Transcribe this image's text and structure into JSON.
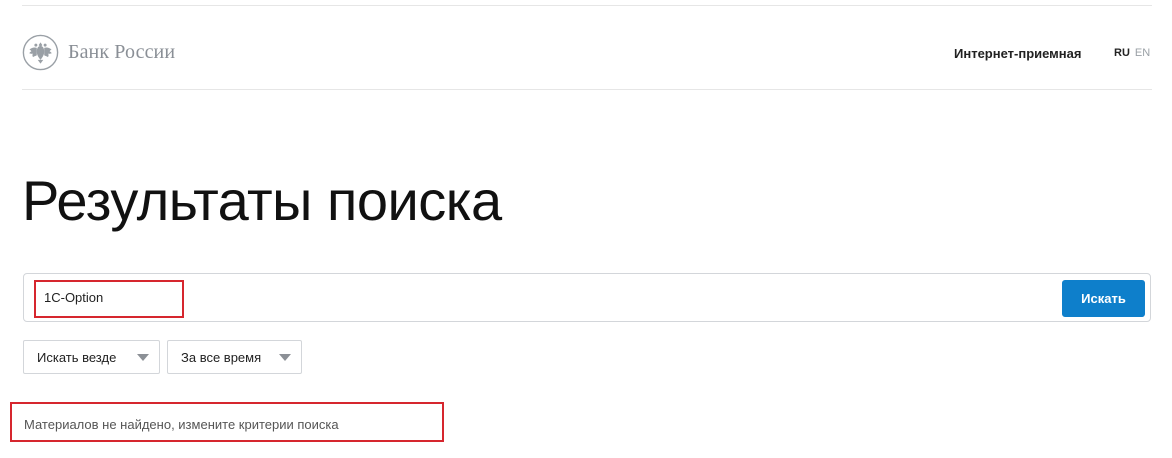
{
  "header": {
    "logo_text": "Банк России",
    "reception_link": "Интернет-приемная",
    "languages": [
      "RU",
      "EN"
    ]
  },
  "page_title": "Результаты поиска",
  "search": {
    "query": "1C-Option",
    "button_label": "Искать"
  },
  "filters": {
    "area": "Искать везде",
    "period": "За все время"
  },
  "results": {
    "empty_message": "Материалов не найдено, измените критерии поиска"
  },
  "colors": {
    "accent": "#0e7fcb",
    "highlight": "#d6262e"
  },
  "icons": {
    "logo": "double-headed-eagle-icon",
    "dropdown": "caret-down-icon"
  }
}
